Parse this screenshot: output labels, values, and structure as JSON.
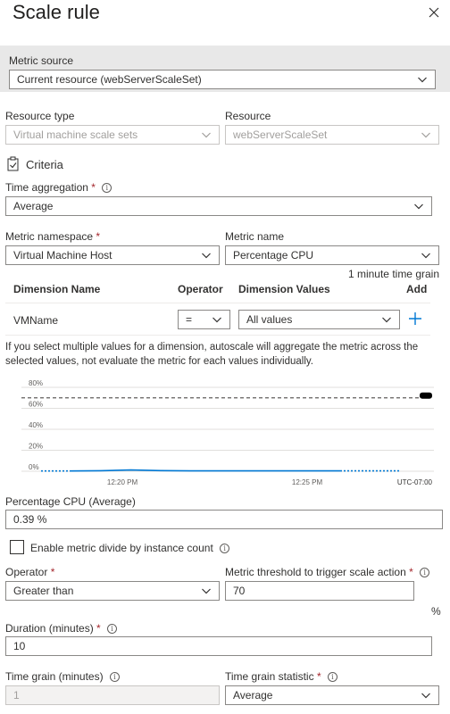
{
  "header": {
    "title": "Scale rule"
  },
  "metric_source": {
    "label": "Metric source",
    "value": "Current resource (webServerScaleSet)"
  },
  "resource_type": {
    "label": "Resource type",
    "value": "Virtual machine scale sets"
  },
  "resource": {
    "label": "Resource",
    "value": "webServerScaleSet"
  },
  "criteria": {
    "label": "Criteria"
  },
  "time_aggregation": {
    "label": "Time aggregation",
    "required": "*",
    "value": "Average"
  },
  "metric_namespace": {
    "label": "Metric namespace",
    "required": "*",
    "value": "Virtual Machine Host"
  },
  "metric_name": {
    "label": "Metric name",
    "value": "Percentage CPU",
    "time_grain_note": "1 minute time grain"
  },
  "dimensions": {
    "headers": [
      "Dimension Name",
      "Operator",
      "Dimension Values",
      "Add"
    ],
    "row": {
      "name": "VMName",
      "operator": "=",
      "values": "All values"
    },
    "note": "If you select multiple values for a dimension, autoscale will aggregate the metric across the selected values, not evaluate the metric for each values individually."
  },
  "chart_data": {
    "type": "line",
    "y_ticks": [
      "80%",
      "60%",
      "40%",
      "20%",
      "0%"
    ],
    "x_ticks": [
      "12:20 PM",
      "12:25 PM"
    ],
    "timezone": "UTC-07:00",
    "ylim": [
      0,
      80
    ],
    "threshold": 70,
    "series": [
      {
        "values": [
          0.3,
          0.3,
          0.5,
          1.2,
          0.6,
          0.4,
          0.4,
          0.4,
          0.4,
          0.4,
          0.4,
          0.4,
          0.4
        ],
        "color": "#0078d4"
      }
    ]
  },
  "metric_summary": {
    "label": "Percentage CPU (Average)",
    "value": "0.39 %"
  },
  "divide": {
    "label": "Enable metric divide by instance count"
  },
  "operator": {
    "label": "Operator",
    "required": "*",
    "value": "Greater than"
  },
  "threshold": {
    "label": "Metric threshold to trigger scale action",
    "required": "*",
    "value": "70",
    "unit": "%"
  },
  "duration": {
    "label": "Duration (minutes)",
    "required": "*",
    "value": "10"
  },
  "time_grain": {
    "label": "Time grain (minutes)",
    "value": "1"
  },
  "time_grain_statistic": {
    "label": "Time grain statistic",
    "required": "*",
    "value": "Average"
  },
  "colors": {
    "accent": "#0078d4",
    "required": "#a4262c",
    "band": "#e8e8e8"
  },
  "icons": {
    "close": "close-icon",
    "criteria": "clipboard-check-icon",
    "info": "info-icon",
    "add": "plus-icon",
    "chevron": "chevron-down-icon"
  }
}
